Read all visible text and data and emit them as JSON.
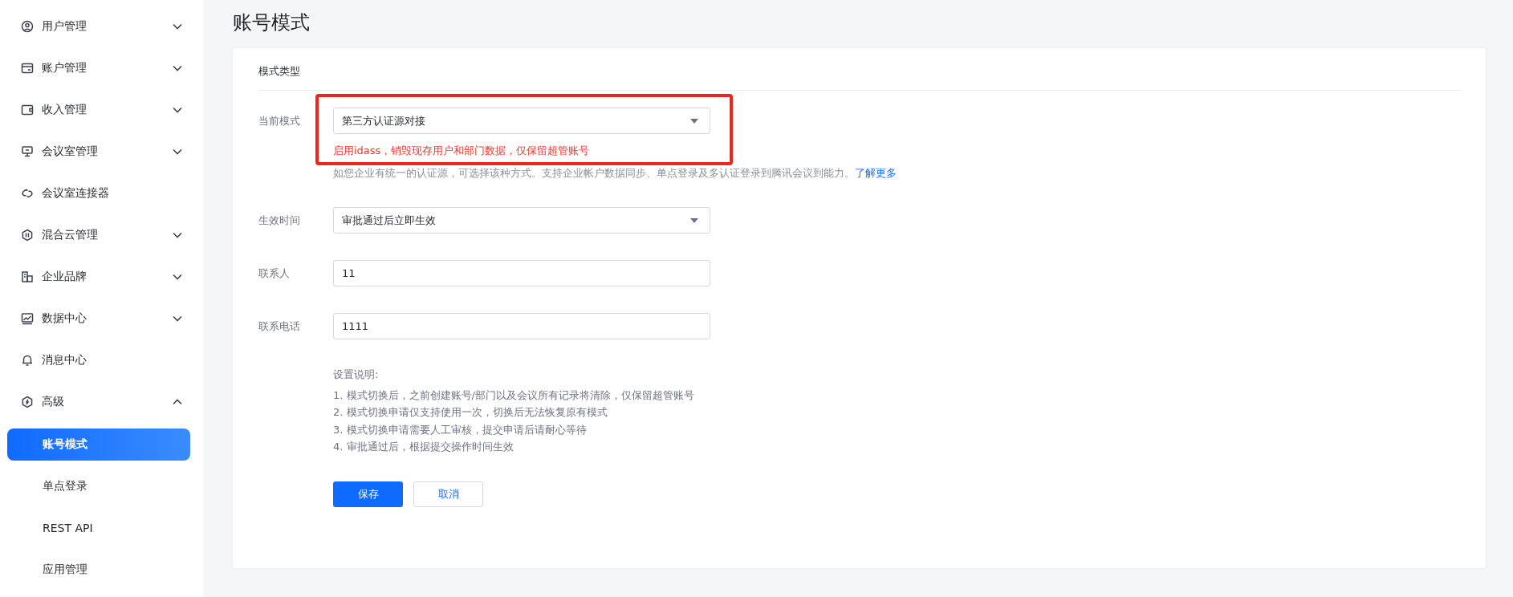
{
  "sidebar": {
    "items": [
      {
        "label": "用户管理",
        "expanded": false
      },
      {
        "label": "账户管理",
        "expanded": false
      },
      {
        "label": "收入管理",
        "expanded": false
      },
      {
        "label": "会议室管理",
        "expanded": false
      },
      {
        "label": "会议室连接器"
      },
      {
        "label": "混合云管理",
        "expanded": false
      },
      {
        "label": "企业品牌",
        "expanded": false
      },
      {
        "label": "数据中心",
        "expanded": false
      },
      {
        "label": "消息中心"
      },
      {
        "label": "高级",
        "expanded": true,
        "children": [
          {
            "label": "账号模式",
            "selected": true
          },
          {
            "label": "单点登录",
            "selected": false
          },
          {
            "label": "REST API",
            "selected": false
          },
          {
            "label": "应用管理",
            "selected": false
          }
        ]
      }
    ]
  },
  "page": {
    "title": "账号模式"
  },
  "form": {
    "section_title": "模式类型",
    "fields": [
      {
        "kind": "select",
        "label": "当前模式",
        "value": "第三方认证源对接",
        "highlighted": true,
        "warning": "启用idass，销毁现存用户和部门数据，仅保留超管账号",
        "help": "如您企业有统一的认证源，可选择该种方式。支持企业帐户数据同步、单点登录及多认证登录到腾讯会议到能力。",
        "help_link": "了解更多"
      },
      {
        "kind": "select",
        "label": "生效时间",
        "value": "审批通过后立即生效",
        "highlighted": false
      },
      {
        "kind": "input",
        "label": "联系人",
        "value": "11",
        "highlighted": false
      },
      {
        "kind": "input",
        "label": "联系电话",
        "value": "1111",
        "highlighted": false
      }
    ],
    "notes_title": "设置说明:",
    "notes": [
      "1. 模式切换后，之前创建账号/部门以及会议所有记录将清除，仅保留超管账号",
      "2. 模式切换申请仅支持使用一次，切换后无法恢复原有模式",
      "3. 模式切换申请需要人工审核，提交申请后请耐心等待",
      "4. 审批通过后，根据提交操作时间生效"
    ],
    "buttons": [
      {
        "label": "保存",
        "kind": "primary"
      },
      {
        "label": "取消",
        "kind": "default"
      }
    ]
  }
}
